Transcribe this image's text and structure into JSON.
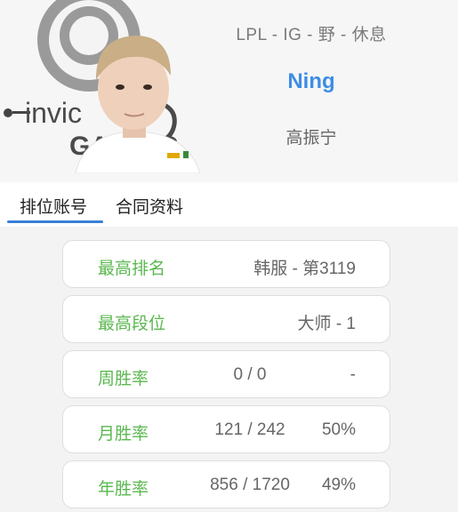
{
  "header": {
    "league_line": "LPL - IG - 野 - 休息",
    "player_name": "Ning",
    "real_name": "高振宁",
    "logo_text_top": "invic",
    "logo_text_bottom": "GAMING",
    "colors": {
      "name_accent": "#3d8de4"
    }
  },
  "tabs": [
    {
      "label": "排位账号",
      "active": true
    },
    {
      "label": "合同资料",
      "active": false
    }
  ],
  "stats": [
    {
      "label": "最高排名",
      "value": "韩服 - 第3119"
    },
    {
      "label": "最高段位",
      "value": "大师 - 1"
    },
    {
      "label": "周胜率",
      "record": "0 / 0",
      "rate": "-"
    },
    {
      "label": "月胜率",
      "record": "121 / 242",
      "rate": "50%"
    },
    {
      "label": "年胜率",
      "record": "856 / 1720",
      "rate": "49%"
    }
  ],
  "colors": {
    "label_green": "#5ab84f",
    "tab_underline": "#3a7fd6"
  }
}
